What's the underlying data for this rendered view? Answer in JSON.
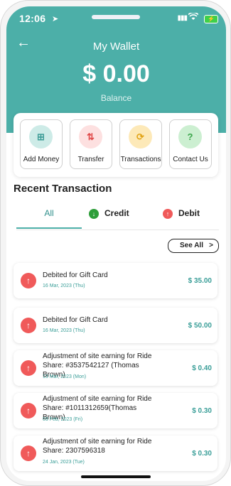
{
  "status": {
    "time": "12:06",
    "signal": "▮▮▮",
    "battery_symbol": "⚡"
  },
  "header": {
    "back_symbol": "←",
    "title": "My Wallet",
    "amount": "$ 0.00",
    "balance_label": "Balance"
  },
  "actions": [
    {
      "label": "Add Money",
      "icon": "wallet-plus-icon",
      "glyph": "⊞",
      "bg": "#cdebe7",
      "fg": "#3c9c96"
    },
    {
      "label": "Transfer",
      "icon": "transfer-icon",
      "glyph": "⇅",
      "bg": "#fde0e0",
      "fg": "#e04848"
    },
    {
      "label": "Transactions",
      "icon": "transactions-icon",
      "glyph": "⟳",
      "bg": "#fde9b8",
      "fg": "#e2a418"
    },
    {
      "label": "Contact Us",
      "icon": "help-icon",
      "glyph": "?",
      "bg": "#ccefd1",
      "fg": "#3aa64a"
    }
  ],
  "recent_title": "Recent Transaction",
  "tabs": {
    "all": "All",
    "credit": "Credit",
    "debit": "Debit",
    "credit_arrow": "↓",
    "debit_arrow": "↑"
  },
  "see_all": {
    "label": "See All",
    "chevron": ">"
  },
  "transactions": [
    {
      "description": "Debited for Gift Card",
      "date": "16 Mar, 2023 (Thu)",
      "amount": "$ 35.00"
    },
    {
      "description": "Debited for Gift Card",
      "date": "16 Mar, 2023 (Thu)",
      "amount": "$ 50.00"
    },
    {
      "description": "Adjustment of site earning for Ride Share: #3537542127 (Thomas Brown)",
      "date": "13 Mar, 2023 (Mon)",
      "amount": "$ 0.40"
    },
    {
      "description": "Adjustment of site earning for Ride Share: #1011312659(Thomas Brown)",
      "date": "03 Feb, 2023 (Fri)",
      "amount": "$ 0.30"
    },
    {
      "description": "Adjustment of site earning for Ride Share: 2307596318",
      "date": "24 Jan, 2023 (Tue)",
      "amount": "$ 0.30"
    }
  ],
  "colors": {
    "brand": "#4cafa8",
    "debit_red": "#f05a5a",
    "credit_green": "#2e9e3a"
  }
}
